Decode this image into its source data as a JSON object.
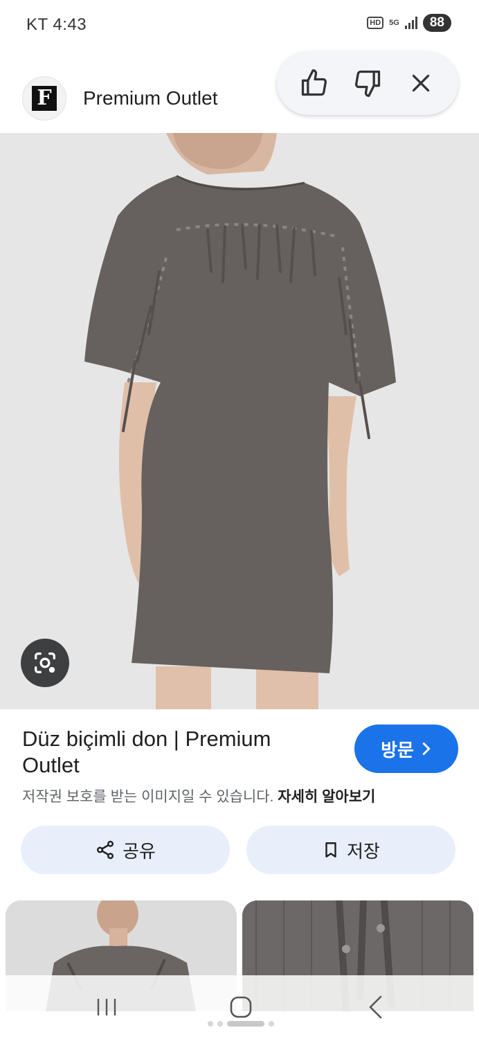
{
  "status_bar": {
    "carrier_time": "KT 4:43",
    "hd": "HD",
    "network": "5G",
    "battery": "88"
  },
  "header": {
    "logo_letter": "F",
    "site_name": "Premium Outlet"
  },
  "icons": {
    "thumbs_up": "thumbs-up-icon",
    "thumbs_down": "thumbs-down-icon",
    "close": "close-icon",
    "lens": "google-lens-icon",
    "share": "share-icon",
    "bookmark": "bookmark-icon"
  },
  "result": {
    "title": "Düz biçimli don | Premium Outlet",
    "visit_label": "방문",
    "copyright_text": "저작권 보호를 받는 이미지일 수 있습니다.",
    "learn_more": "자세히 알아보기"
  },
  "actions": {
    "share_label": "공유",
    "save_label": "저장"
  },
  "colors": {
    "accent": "#1a73e8",
    "action_bg": "#e8effb",
    "dress": "#66615e",
    "image_bg": "#e6e6e6"
  }
}
